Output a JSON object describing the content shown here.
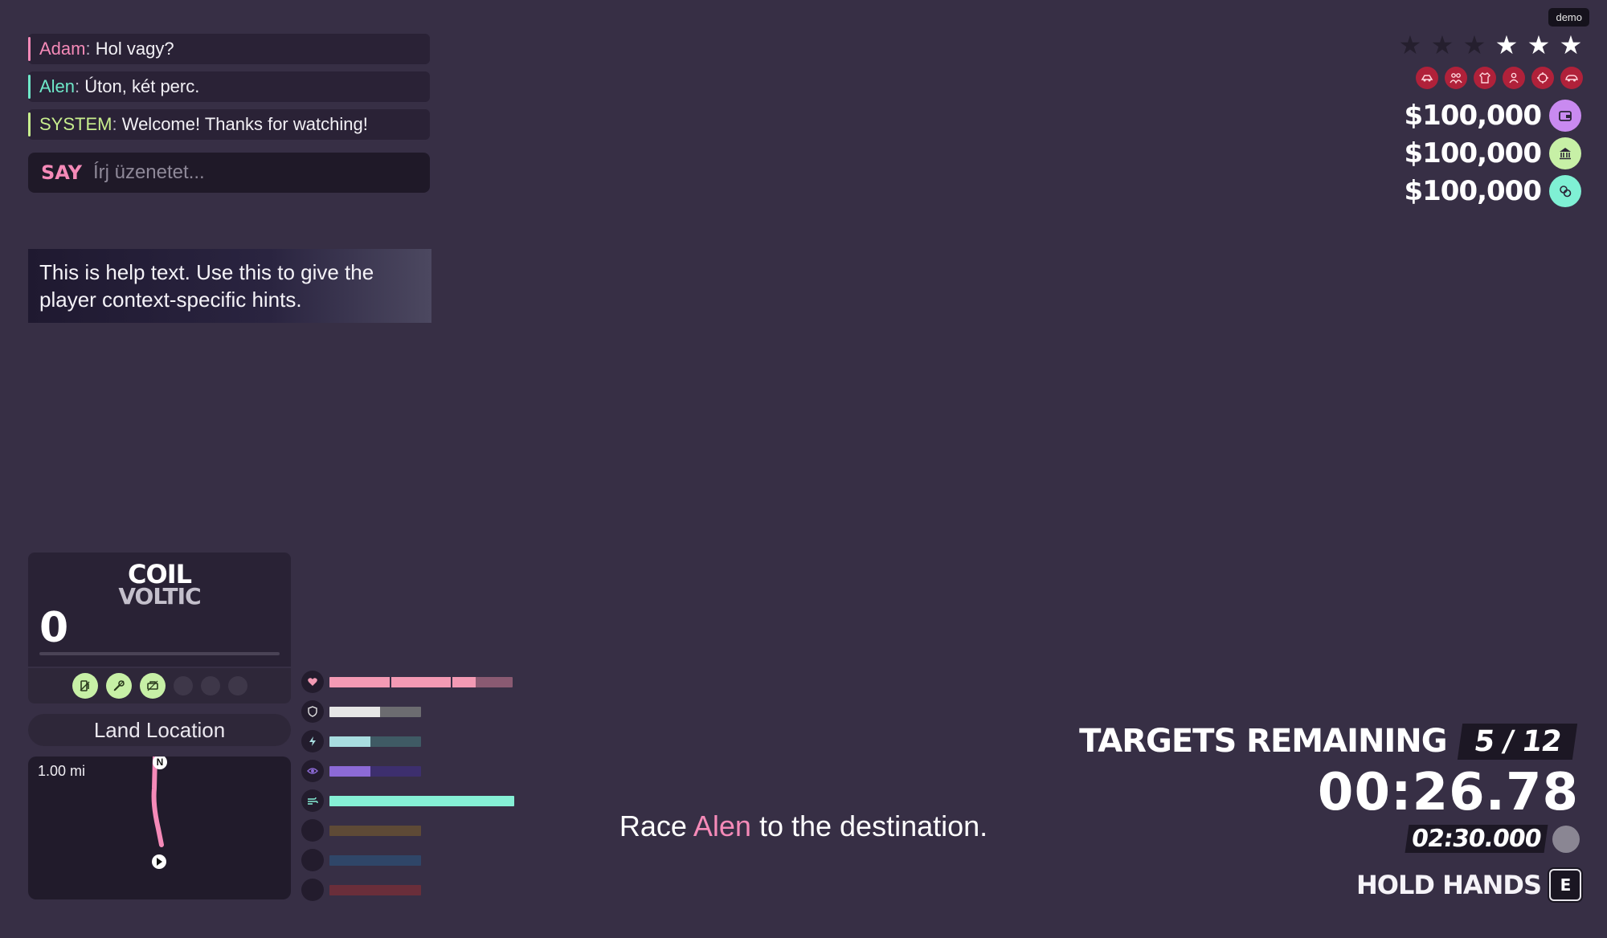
{
  "demo_badge": "demo",
  "chat": {
    "messages": [
      {
        "author": "Adam",
        "text": " Hol vagy?",
        "color": "#f58ab8"
      },
      {
        "author": "Alen",
        "text": " Úton, két perc.",
        "color": "#6ee8c9"
      },
      {
        "author": "SYSTEM",
        "text": " Welcome! Thanks for watching!",
        "color": "#c8ee8e"
      }
    ],
    "say_label": "SAY",
    "placeholder": "Írj üzenetet..."
  },
  "help_text": "This is help text. Use this to give the player context-specific hints.",
  "wanted": {
    "stars_total": 6,
    "stars_filled": 3
  },
  "offense_icons": [
    "speeding-car-icon",
    "group-icon",
    "shirt-icon",
    "person-icon",
    "crosshair-icon",
    "car-icon"
  ],
  "money": [
    {
      "value": "$100,000",
      "icon": "wallet-icon",
      "color": "#c98af0"
    },
    {
      "value": "$100,000",
      "icon": "bank-icon",
      "color": "#c7f0a6"
    },
    {
      "value": "$100,000",
      "icon": "coins-icon",
      "color": "#7ff0d4"
    }
  ],
  "vehicle": {
    "name_top": "COIL",
    "name_bottom": "VOLTIC",
    "speed": "0",
    "icons": [
      {
        "name": "fuel-icon",
        "on": true
      },
      {
        "name": "wrench-icon",
        "on": true
      },
      {
        "name": "engine-icon",
        "on": true
      },
      {
        "name": "empty-slot",
        "on": false
      },
      {
        "name": "empty-slot",
        "on": false
      },
      {
        "name": "empty-slot",
        "on": false
      }
    ]
  },
  "location": "Land Location",
  "minimap": {
    "distance": "1.00 mi",
    "north": "N"
  },
  "stats": [
    {
      "name": "health",
      "icon": "heart-icon",
      "fill": 0.8,
      "color": "#f39ab4",
      "track": "#8a5a72",
      "width": 228
    },
    {
      "name": "armor",
      "icon": "shield-icon",
      "fill": 0.55,
      "color": "#e6e6e6",
      "track": "#6c6c70",
      "width": 114
    },
    {
      "name": "stamina",
      "icon": "lightning-icon",
      "fill": 0.45,
      "color": "#a8dde0",
      "track": "#3f5a64",
      "width": 114
    },
    {
      "name": "stealth",
      "icon": "eye-icon",
      "fill": 0.45,
      "color": "#8c6ad6",
      "track": "#3d2f6e",
      "width": 114
    },
    {
      "name": "lung",
      "icon": "wind-icon",
      "fill": 1.0,
      "color": "#86f0d6",
      "track": "#3e6a60",
      "width": 230
    },
    {
      "name": "bar6",
      "icon": "empty-icon",
      "fill": 0.0,
      "color": "#a67c4a",
      "track": "#5e4a36",
      "width": 114
    },
    {
      "name": "bar7",
      "icon": "empty-icon",
      "fill": 0.0,
      "color": "#4a6a9a",
      "track": "#2f4668",
      "width": 114
    },
    {
      "name": "bar8",
      "icon": "empty-icon",
      "fill": 0.0,
      "color": "#a04040",
      "track": "#6a2e3a",
      "width": 114
    }
  ],
  "objective": {
    "before": "Race ",
    "name": "Alen",
    "after": " to the destination.",
    "name_color": "#f58ab8"
  },
  "targets": {
    "label": "TARGETS REMAINING",
    "count": "5 / 12"
  },
  "timer": "00:26.78",
  "sub_timer": "02:30.000",
  "hint": {
    "label": "HOLD HANDS",
    "key": "E"
  }
}
